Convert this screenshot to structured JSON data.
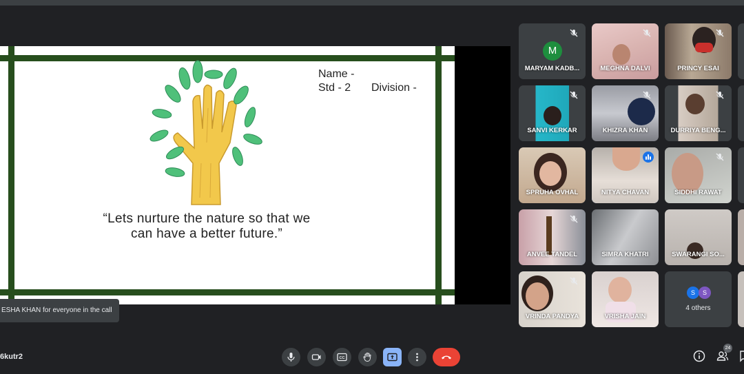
{
  "slide": {
    "name_label": "Name -",
    "std_label": "Std - 2",
    "division_label": "Division -",
    "quote": "“Lets nurture the nature so that we can have a better future.”"
  },
  "toast": {
    "text": "ESHA KHAN for everyone in the call"
  },
  "participants": [
    {
      "name": "MARYAM KADB...",
      "muted": true,
      "avatar_letter": "M"
    },
    {
      "name": "MEGHNA DALVI",
      "muted": true
    },
    {
      "name": "PRINCY ESAI",
      "muted": true
    },
    {
      "name": "SANVI KERKAR",
      "muted": true
    },
    {
      "name": "KHIZRA KHAN",
      "muted": true
    },
    {
      "name": "DURRIYA BENG...",
      "muted": true
    },
    {
      "name": "SPRUHA OVHAL",
      "muted": false
    },
    {
      "name": "NITYA CHAVAN",
      "muted": false,
      "speaking": true
    },
    {
      "name": "SIDDHI RAWAT",
      "muted": true
    },
    {
      "name": "ANVEE TANDEL",
      "muted": true
    },
    {
      "name": "SIMRA KHATRI",
      "muted": false
    },
    {
      "name": "SWARANGI SO...",
      "muted": false
    },
    {
      "name": "VRINDA PANDYA",
      "muted": true
    },
    {
      "name": "VRISHA JAIN",
      "muted": false
    }
  ],
  "others_tile": {
    "label": "4 others",
    "avatar_letters": [
      "S",
      "S"
    ]
  },
  "bottom": {
    "meeting_code": "6kutr2",
    "people_count": "24"
  },
  "colors": {
    "accent": "#8ab4f8",
    "end_call": "#ea4335",
    "frame_green": "#274e1d",
    "speaking_blue": "#1a73e8"
  },
  "icons": [
    "mic-icon",
    "camera-icon",
    "captions-icon",
    "raise-hand-icon",
    "present-icon",
    "more-icon",
    "end-call-icon",
    "info-icon",
    "people-icon",
    "chat-icon",
    "mic-off-icon"
  ]
}
